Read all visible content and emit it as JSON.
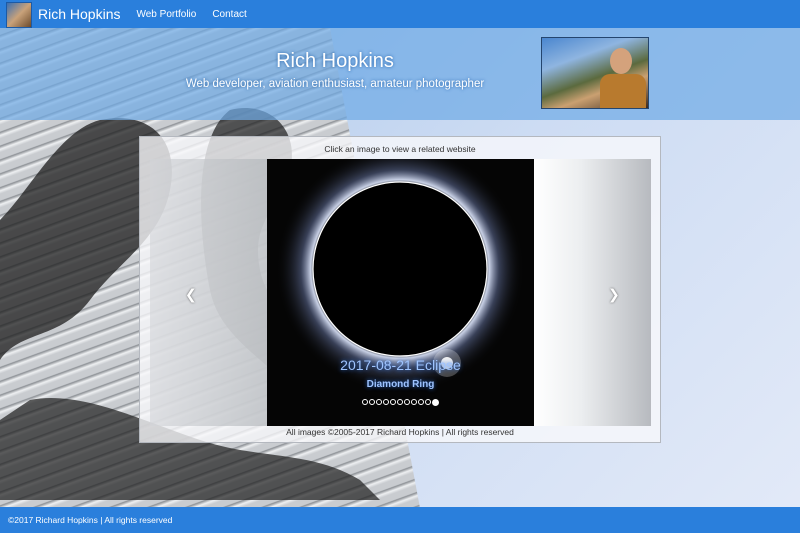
{
  "navbar": {
    "brand": "Rich Hopkins",
    "links": [
      "Web Portfolio",
      "Contact"
    ]
  },
  "header": {
    "title": "Rich Hopkins",
    "subtitle": "Web developer, aviation enthusiast, amateur photographer"
  },
  "carousel": {
    "instruction": "Click an image to view a related website",
    "slide": {
      "title": "2017-08-21 Eclipse",
      "subtitle": "Diamond Ring"
    },
    "indicator_count": 11,
    "active_indicator": 11,
    "copyright": "All images ©2005-2017 Richard Hopkins | All rights reserved",
    "prev_icon": "chevron-left-icon",
    "next_icon": "chevron-right-icon"
  },
  "footer": {
    "text": "©2017 Richard Hopkins | All rights reserved"
  },
  "colors": {
    "nav_blue": "#2a7fdc",
    "header_blue": "#6eaae6",
    "caption_blue": "#9fc4ff"
  }
}
